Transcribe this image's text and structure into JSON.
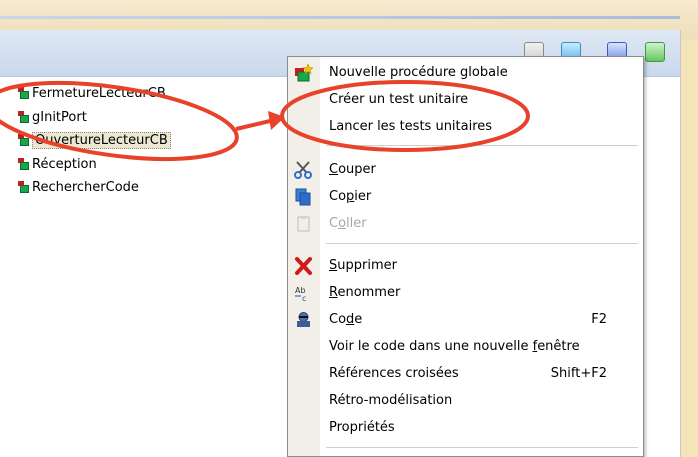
{
  "tree": {
    "items": [
      {
        "label": "FermetureLecteurCB"
      },
      {
        "label": "gInitPort"
      },
      {
        "label": "OuvertureLecteurCB",
        "selected": true
      },
      {
        "label": "Réception"
      },
      {
        "label": "RechercherCode"
      }
    ]
  },
  "toolbar": {
    "view_buttons": [
      {
        "color": "#d9d9d9"
      },
      {
        "color": "#5fb6e8"
      },
      {
        "color": "#6c8fe2"
      },
      {
        "color": "#63c860"
      }
    ]
  },
  "context_menu": {
    "items": [
      {
        "label": "Nouvelle procédure globale",
        "icon": "new-procedure-icon"
      },
      {
        "label": "Créer un test unitaire"
      },
      {
        "label": "Lancer les tests unitaires"
      },
      {
        "label": "Couper",
        "icon": "scissors-icon"
      },
      {
        "label": "Copier",
        "icon": "copy-icon"
      },
      {
        "label": "Coller",
        "icon": "paste-icon",
        "disabled": true
      },
      {
        "label": "Supprimer",
        "icon": "delete-icon"
      },
      {
        "label": "Renommer",
        "icon": "rename-icon"
      },
      {
        "label": "Code",
        "icon": "code-icon",
        "shortcut": "F2"
      },
      {
        "label": "Voir le code dans une nouvelle fenêtre"
      },
      {
        "label": "Références croisées",
        "shortcut": "Shift+F2"
      },
      {
        "label": "Rétro-modélisation"
      },
      {
        "label": "Propriétés"
      }
    ]
  },
  "annotation": {
    "color": "#e8432a"
  }
}
